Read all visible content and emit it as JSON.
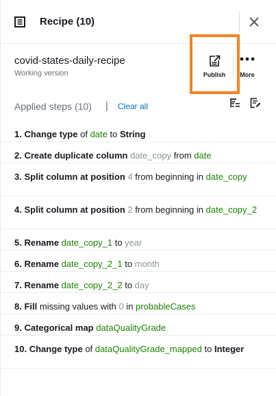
{
  "header": {
    "title": "Recipe (10)"
  },
  "recipe": {
    "name": "covid-states-daily-recipe",
    "subtitle": "Working version"
  },
  "actions": {
    "publish_label": "Publish",
    "more_label": "More"
  },
  "steps_header": {
    "title": "Applied steps (10)",
    "separator": "|",
    "clear_all": "Clear all"
  },
  "steps": [
    {
      "n": "1.",
      "parts": [
        [
          "kw",
          "Change type"
        ],
        [
          "plain",
          " of "
        ],
        [
          "col",
          "date"
        ],
        [
          "plain",
          " to "
        ],
        [
          "strong",
          "String"
        ]
      ]
    },
    {
      "n": "2.",
      "parts": [
        [
          "kw",
          "Create duplicate column"
        ],
        [
          "plain",
          " "
        ],
        [
          "val",
          "date_copy"
        ],
        [
          "plain",
          " from "
        ],
        [
          "col",
          "date"
        ]
      ]
    },
    {
      "n": "3.",
      "parts": [
        [
          "kw",
          "Split column at position"
        ],
        [
          "plain",
          " "
        ],
        [
          "val",
          "4"
        ],
        [
          "plain",
          " from beginning  in "
        ],
        [
          "col",
          "date_copy"
        ]
      ]
    },
    {
      "n": "4.",
      "parts": [
        [
          "kw",
          "Split column at position"
        ],
        [
          "plain",
          " "
        ],
        [
          "val",
          "2"
        ],
        [
          "plain",
          " from beginning  in "
        ],
        [
          "col",
          "date_copy_2"
        ]
      ]
    },
    {
      "n": "5.",
      "parts": [
        [
          "kw",
          "Rename"
        ],
        [
          "plain",
          " "
        ],
        [
          "col",
          "date_copy_1"
        ],
        [
          "plain",
          " to "
        ],
        [
          "val",
          "year"
        ]
      ]
    },
    {
      "n": "6.",
      "parts": [
        [
          "kw",
          "Rename"
        ],
        [
          "plain",
          " "
        ],
        [
          "col",
          "date_copy_2_1"
        ],
        [
          "plain",
          " to "
        ],
        [
          "val",
          "month"
        ]
      ]
    },
    {
      "n": "7.",
      "parts": [
        [
          "kw",
          "Rename"
        ],
        [
          "plain",
          " "
        ],
        [
          "col",
          "date_copy_2_2"
        ],
        [
          "plain",
          " to "
        ],
        [
          "val",
          "day"
        ]
      ]
    },
    {
      "n": "8.",
      "parts": [
        [
          "kw",
          "Fill"
        ],
        [
          "plain",
          " missing values with "
        ],
        [
          "val",
          "0"
        ],
        [
          "plain",
          " in "
        ],
        [
          "col",
          "probableCases"
        ]
      ]
    },
    {
      "n": "9.",
      "parts": [
        [
          "kw",
          "Categorical map"
        ],
        [
          "plain",
          " "
        ],
        [
          "col",
          "dataQualityGrade"
        ]
      ]
    },
    {
      "n": "10.",
      "parts": [
        [
          "kw",
          "Change type"
        ],
        [
          "plain",
          " of "
        ],
        [
          "col",
          "dataQualityGrade_mapped"
        ],
        [
          "plain",
          " to "
        ],
        [
          "strong",
          "Integer"
        ]
      ]
    }
  ],
  "icons": {
    "header": "recipe-list-icon",
    "close": "close-icon",
    "publish": "publish-icon",
    "more": "more-dots-icon",
    "steps_a": "filter-list-icon",
    "steps_b": "edit-list-icon"
  },
  "colors": {
    "highlight": "#f58220",
    "link": "#0073bb",
    "column": "#1d8102",
    "value": "#879596"
  }
}
